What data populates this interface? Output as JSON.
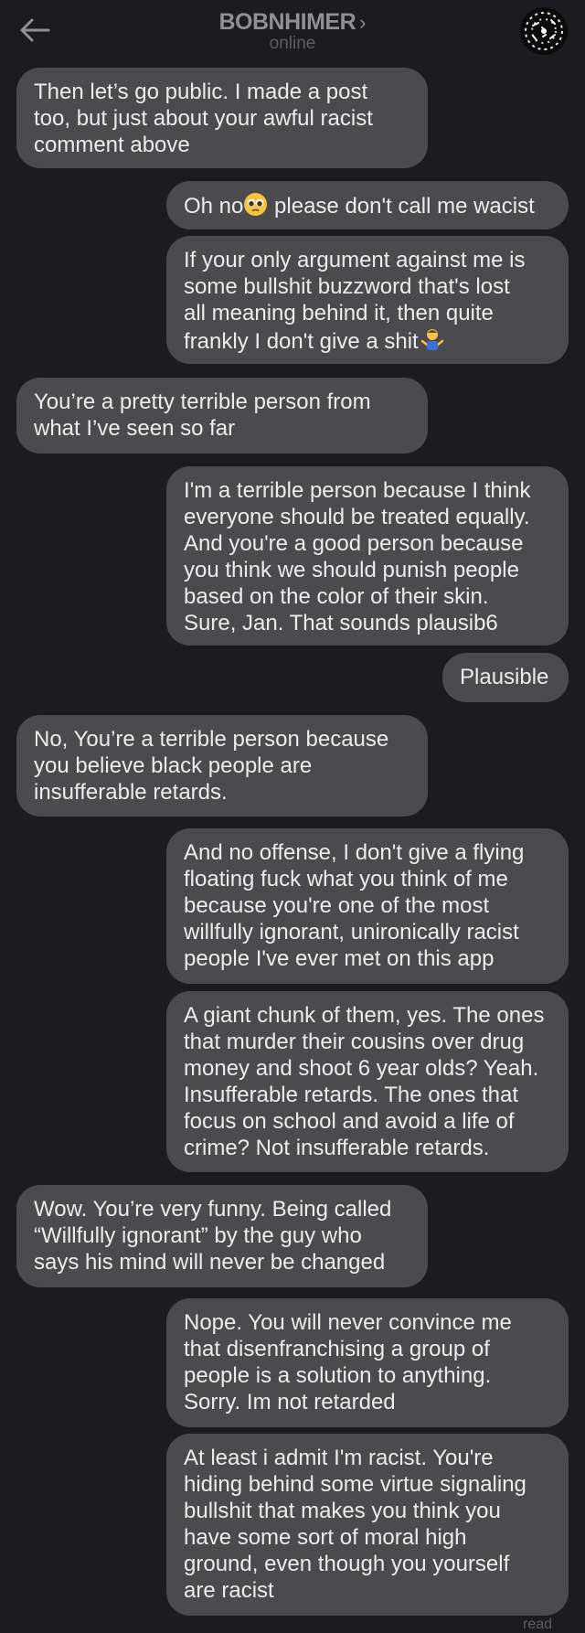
{
  "header": {
    "title": "BOBNHIMER",
    "title_chevron": "›",
    "status": "online",
    "back_icon": "arrow-left-icon",
    "avatar_icon": "avatar"
  },
  "colors": {
    "background": "#1c1c20",
    "bubble": "#4b4b4e",
    "text": "#ececec",
    "muted": "#8f8f94"
  },
  "messages": [
    {
      "side": "in",
      "text": "Then let’s go public. I made a post\ntoo, but just about your awful racist\ncomment above"
    },
    {
      "side": "out",
      "text_before": "Oh no",
      "emoji": "pleading-face-emoji",
      "text_after": " please don't call me wacist"
    },
    {
      "side": "out",
      "text": "If your only argument against me is\nsome bullshit buzzword that's lost\nall meaning behind it, then quite\nfrankly I don't give a shit",
      "emoji": "man-shrugging-emoji"
    },
    {
      "side": "in",
      "text": "You’re a pretty terrible person from\nwhat I’ve seen so far"
    },
    {
      "side": "out",
      "text": "I'm a terrible person because I think\neveryone should be treated equally.\nAnd you're a good person because\nyou think we should punish people\nbased on the color of their skin.\nSure, Jan. That sounds plausib6"
    },
    {
      "side": "out",
      "text": "Plausible"
    },
    {
      "side": "in",
      "text": "No, You’re a terrible person because\nyou believe black people are\ninsufferable retards."
    },
    {
      "side": "out",
      "text": "And no offense, I don't give a flying\nfloating fuck what you think of me\nbecause you're one of the most\nwillfully ignorant, unironically racist\npeople I've ever met on this app"
    },
    {
      "side": "out",
      "text": "A giant chunk of them, yes. The ones\nthat murder their cousins over drug\nmoney and shoot 6 year olds? Yeah.\nInsufferable retards. The ones that\nfocus on school and avoid a life of\ncrime? Not insufferable retards."
    },
    {
      "side": "in",
      "text": "Wow. You’re very funny. Being called\n“Willfully ignorant” by the guy who\nsays his mind will never be changed"
    },
    {
      "side": "out",
      "text": "Nope. You will never convince me\nthat disenfranchising a group of\npeople is a solution to anything.\nSorry. Im not retarded"
    },
    {
      "side": "out",
      "text": "At least i admit I'm racist. You're\nhiding behind some virtue signaling\nbullshit that makes you think you\nhave some sort of moral high\nground, even though you yourself\nare racist"
    }
  ],
  "read_receipt": "read"
}
